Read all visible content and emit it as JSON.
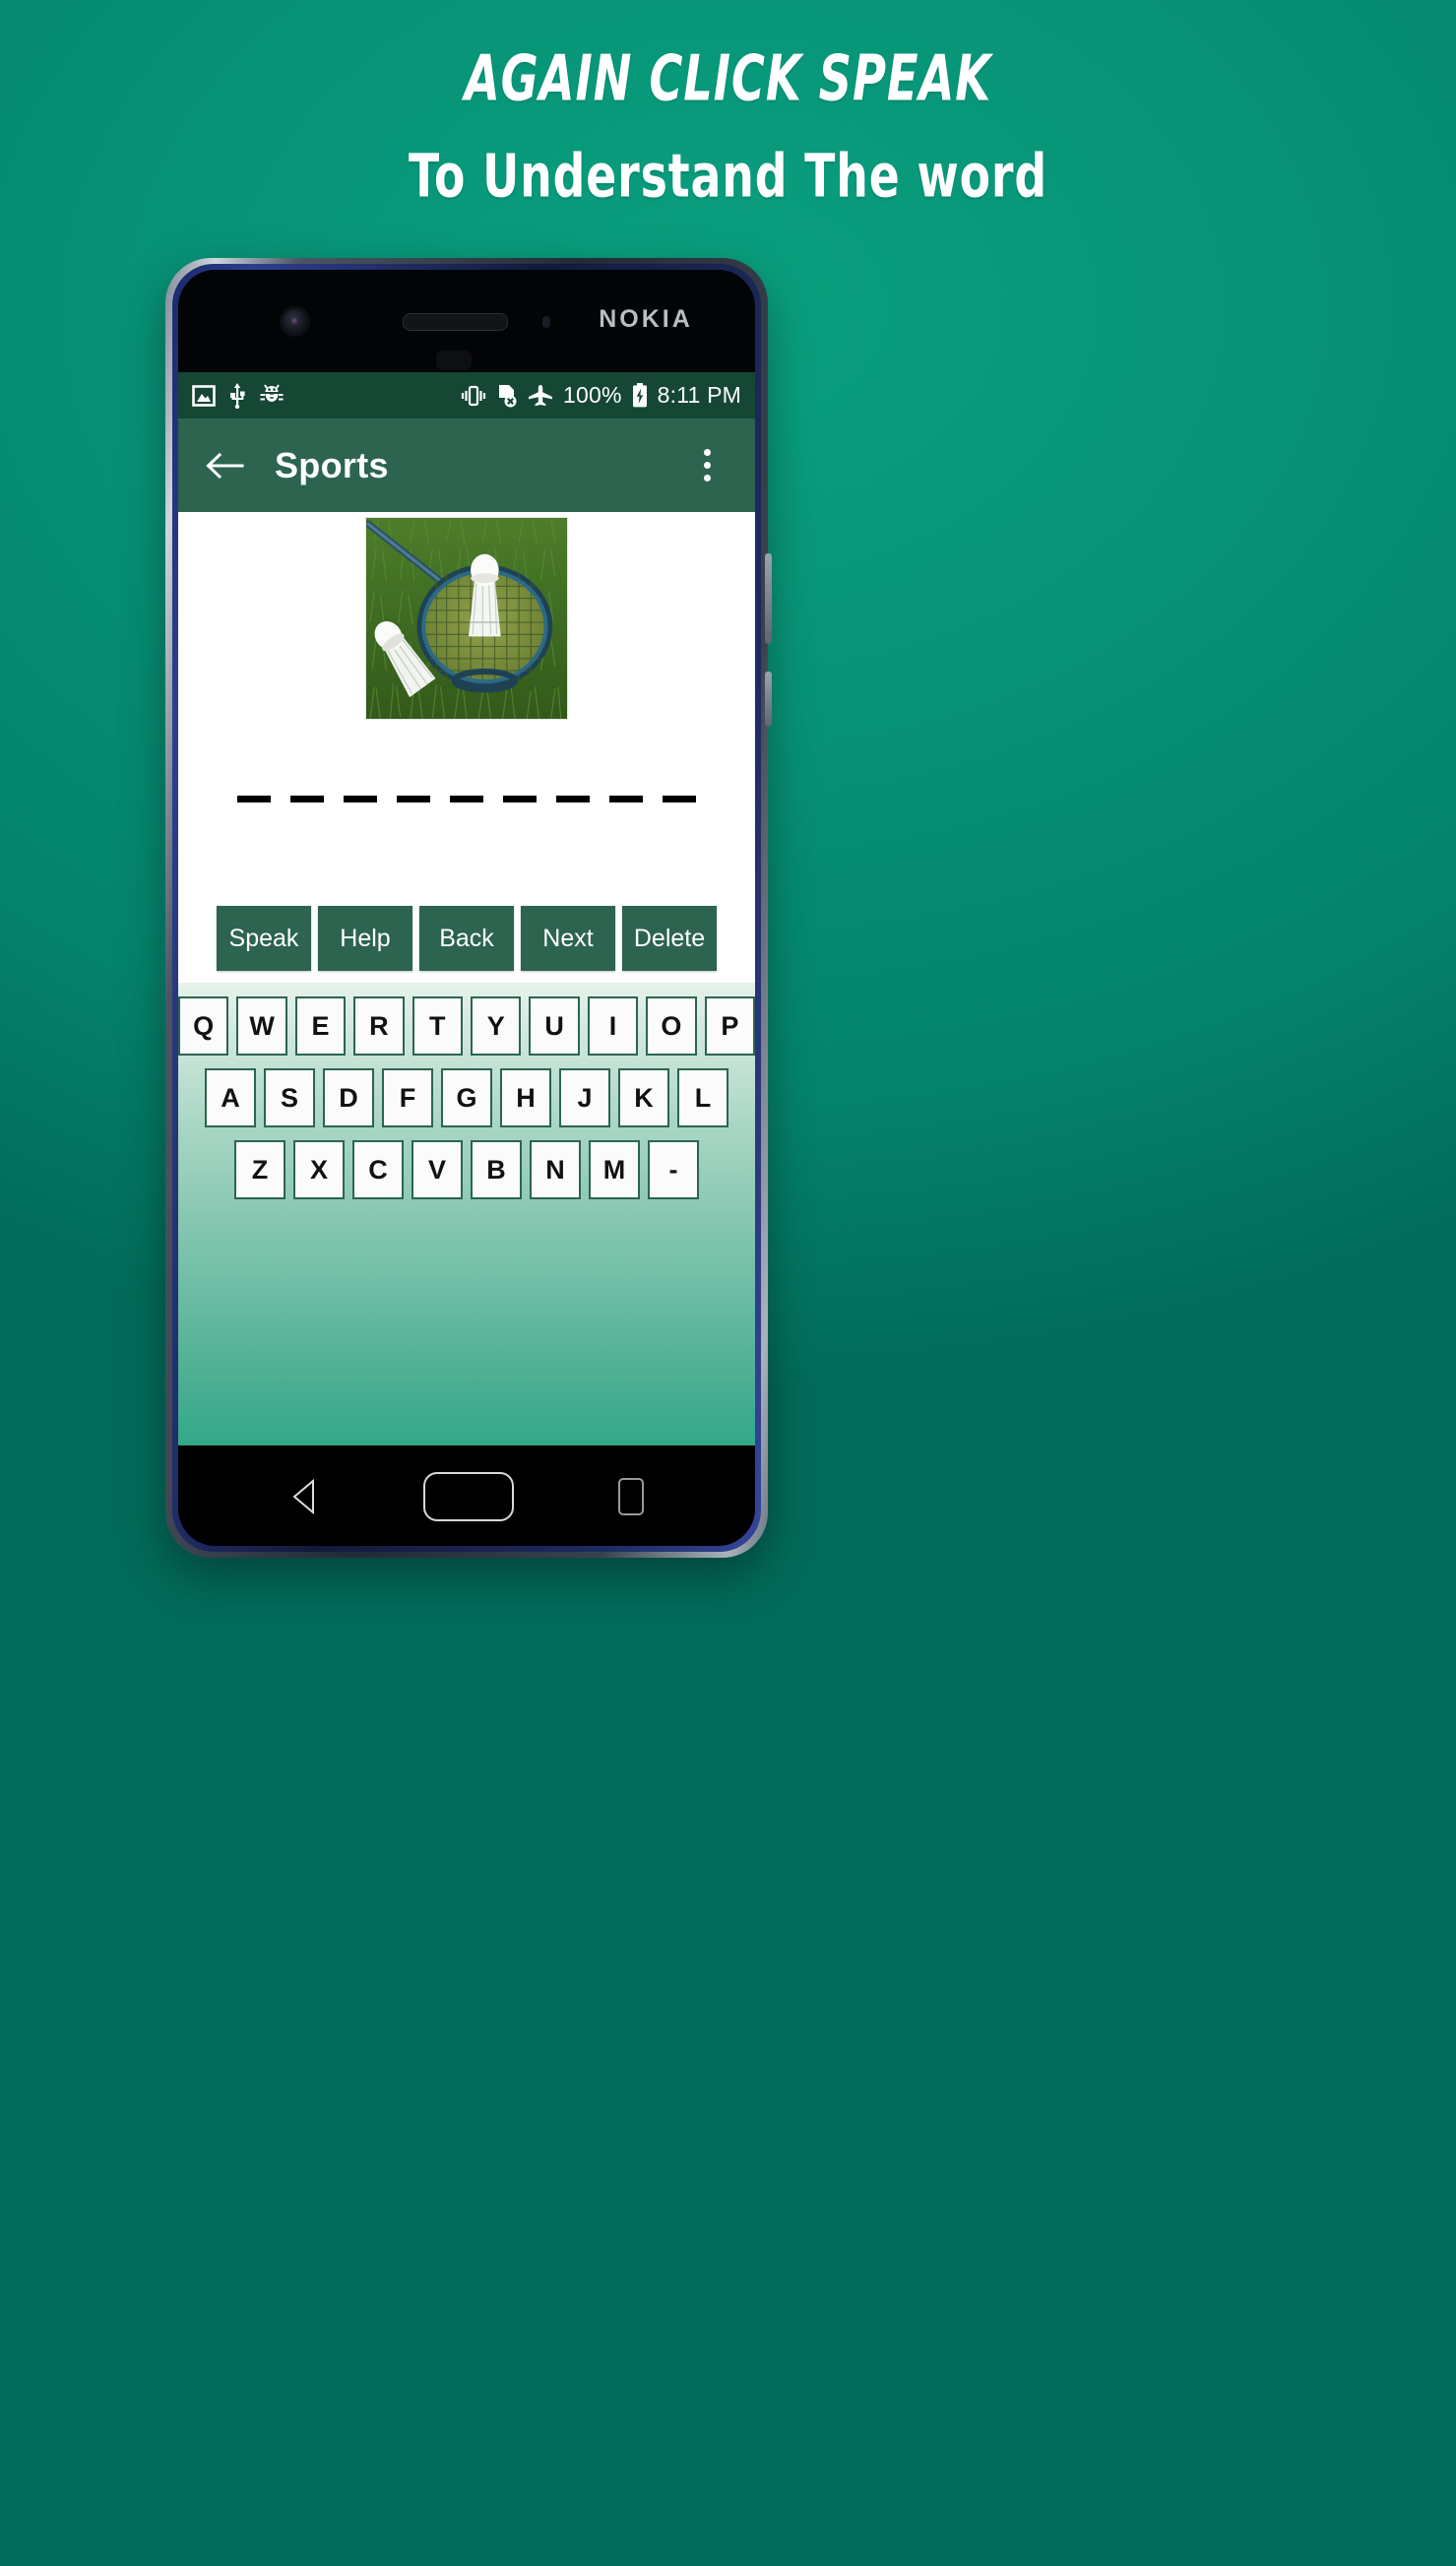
{
  "promo": {
    "title": "AGAIN CLICK SPEAK",
    "subtitle": "To Understand The word",
    "background_color": "#089176"
  },
  "device": {
    "brand": "NOKIA",
    "icons": {
      "front_camera": "camera-icon",
      "earpiece": "earpiece-speaker",
      "proximity_sensor": "sensor-dot"
    }
  },
  "status_bar": {
    "background_color": "#154734",
    "left_icons": [
      "image-icon",
      "usb-icon",
      "bug-icon"
    ],
    "right_icons": [
      "vibrate-icon",
      "no-sim-icon",
      "airplane-mode-icon",
      "battery-charging-icon"
    ],
    "battery_percent": "100%",
    "time": "8:11 PM"
  },
  "toolbar": {
    "background_color": "#2c6450",
    "back_icon": "arrow-left-icon",
    "title": "Sports",
    "overflow_icon": "more-vertical-icon"
  },
  "content": {
    "image_alt": "badminton racket with two shuttlecocks on grass",
    "blank_count": 9,
    "blank_char": "_"
  },
  "actions": {
    "buttons": [
      {
        "label": "Speak",
        "name": "speak-button"
      },
      {
        "label": "Help",
        "name": "help-button"
      },
      {
        "label": "Back",
        "name": "back-button"
      },
      {
        "label": "Next",
        "name": "next-button"
      },
      {
        "label": "Delete",
        "name": "delete-button"
      }
    ],
    "button_color": "#2c6450",
    "button_text_color": "#ffffff"
  },
  "keyboard": {
    "rows": [
      [
        "Q",
        "W",
        "E",
        "R",
        "T",
        "Y",
        "U",
        "I",
        "O",
        "P"
      ],
      [
        "A",
        "S",
        "D",
        "F",
        "G",
        "H",
        "J",
        "K",
        "L"
      ],
      [
        "Z",
        "X",
        "C",
        "V",
        "B",
        "N",
        "M",
        "-"
      ]
    ],
    "key_background": "#fbfbfb",
    "key_border": "#2c6450"
  },
  "nav_bar": {
    "buttons": [
      {
        "name": "nav-back-button",
        "icon": "triangle-left-icon"
      },
      {
        "name": "nav-home-button",
        "icon": "home-pill-icon"
      },
      {
        "name": "nav-recents-button",
        "icon": "square-rounded-icon"
      }
    ]
  }
}
